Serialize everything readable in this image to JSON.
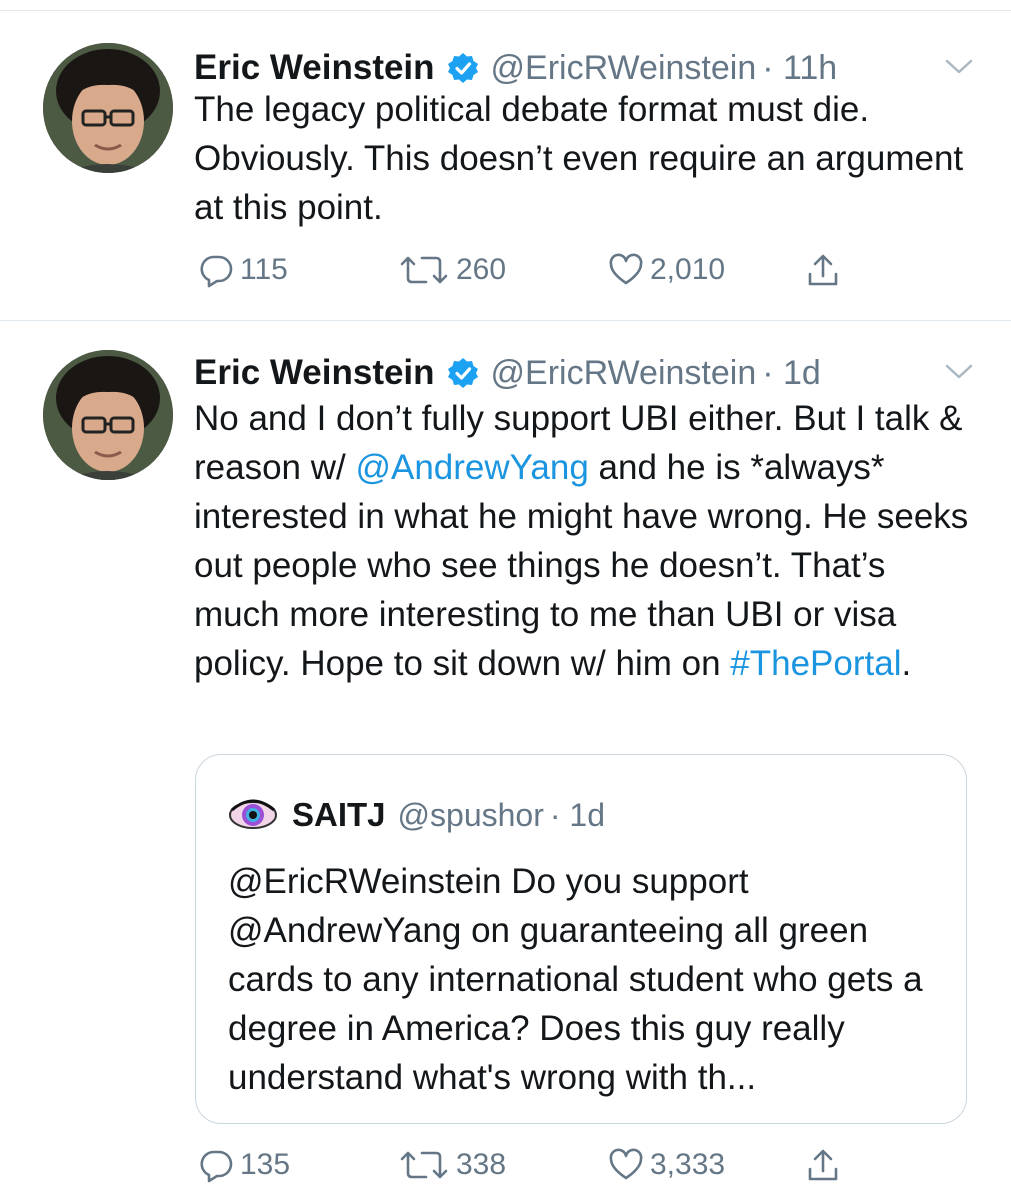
{
  "tweets": [
    {
      "author": "Eric Weinstein",
      "handle": "@EricRWeinstein",
      "time": "· 11h",
      "text": "The legacy political debate format must die. Obviously. This doesn’t even require an argument at this point.",
      "replies": "115",
      "retweets": "260",
      "likes": "2,010"
    },
    {
      "author": "Eric Weinstein",
      "handle": "@EricRWeinstein",
      "time": "· 1d",
      "text_before_mention": "No and I don’t fully support UBI either. But I talk & reason w/ ",
      "mention": "@AndrewYang",
      "text_middle": " and he is *always* interested in what he might have wrong. He seeks out people who see things he doesn’t. That’s much more interesting to me than UBI or visa policy. Hope to sit down w/ him on ",
      "hashtag": "#ThePortal",
      "text_after": ".",
      "quote": {
        "author": "SAITJ",
        "handle": "@spushor",
        "time": "· 1d",
        "text": "@EricRWeinstein Do you support @AndrewYang on guaranteeing all green cards to any international student who gets a degree in America? Does this guy really understand what's wrong with th..."
      },
      "replies": "135",
      "retweets": "338",
      "likes": "3,333"
    }
  ],
  "colors": {
    "link": "#1b95e0",
    "secondary_text": "#657786",
    "divider": "#e1e8ed",
    "verified": "#1da1f2"
  },
  "icons": [
    "verified-badge-icon",
    "chevron-down-icon",
    "reply-icon",
    "retweet-icon",
    "like-icon",
    "share-icon"
  ]
}
